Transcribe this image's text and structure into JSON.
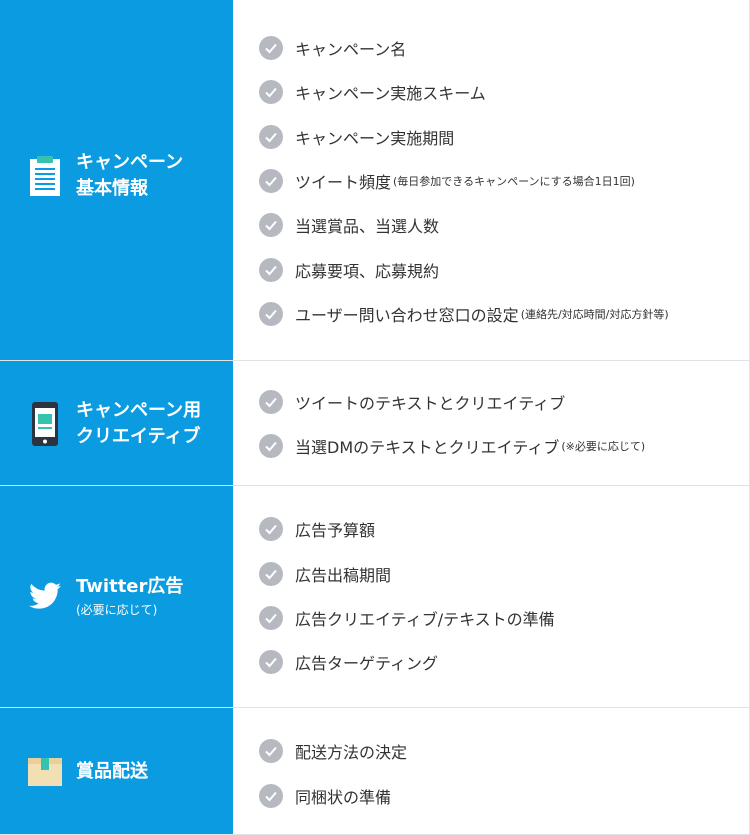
{
  "sections": [
    {
      "title_line1": "キャンペーン",
      "title_line2": "基本情報",
      "icon": "document-icon",
      "items": [
        {
          "label": "キャンペーン名",
          "note": ""
        },
        {
          "label": "キャンペーン実施スキーム",
          "note": ""
        },
        {
          "label": "キャンペーン実施期間",
          "note": ""
        },
        {
          "label": "ツイート頻度",
          "note": "(毎日参加できるキャンペーンにする場合1日1回)"
        },
        {
          "label": "当選賞品、当選人数",
          "note": ""
        },
        {
          "label": "応募要項、応募規約",
          "note": ""
        },
        {
          "label": "ユーザー問い合わせ窓口の設定",
          "note": "(連絡先/対応時間/対応方針等)"
        }
      ]
    },
    {
      "title_line1": "キャンペーン用",
      "title_line2": "クリエイティブ",
      "icon": "smartphone-icon",
      "items": [
        {
          "label": "ツイートのテキストとクリエイティブ",
          "note": ""
        },
        {
          "label": "当選DMのテキストとクリエイティブ",
          "note": "(※必要に応じて)"
        }
      ]
    },
    {
      "title_line1": "Twitter広告",
      "subtitle": "(必要に応じて)",
      "icon": "twitter-bird-icon",
      "items": [
        {
          "label": "広告予算額",
          "note": ""
        },
        {
          "label": "広告出稿期間",
          "note": ""
        },
        {
          "label": "広告クリエイティブ/テキストの準備",
          "note": ""
        },
        {
          "label": "広告ターゲティング",
          "note": ""
        }
      ]
    },
    {
      "title_line1": "賞品配送",
      "icon": "package-box-icon",
      "items": [
        {
          "label": "配送方法の決定",
          "note": ""
        },
        {
          "label": "同梱状の準備",
          "note": ""
        }
      ]
    }
  ],
  "colors": {
    "left_panel": "#0a9be0",
    "check_circle": "#b7b9c1",
    "text": "#333333",
    "border": "#dfe3e8"
  }
}
